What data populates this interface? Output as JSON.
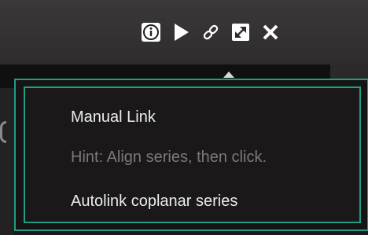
{
  "toolbar": {
    "buttons": [
      {
        "name": "info",
        "icon": "info-icon"
      },
      {
        "name": "play",
        "icon": "play-icon"
      },
      {
        "name": "link",
        "icon": "link-icon"
      },
      {
        "name": "expand",
        "icon": "expand-icon"
      },
      {
        "name": "close",
        "icon": "close-icon"
      }
    ]
  },
  "popup": {
    "items": [
      {
        "label": "Manual Link",
        "enabled": true
      },
      {
        "label": "Hint: Align series, then click.",
        "enabled": false
      },
      {
        "label": "Autolink coplanar series",
        "enabled": true
      }
    ]
  },
  "colors": {
    "accent_border": "#1e9e82",
    "text_primary": "#ececec",
    "text_hint": "#7a7a7a",
    "popup_background": "#1a1819",
    "toolbar_background": "#3a3839"
  }
}
